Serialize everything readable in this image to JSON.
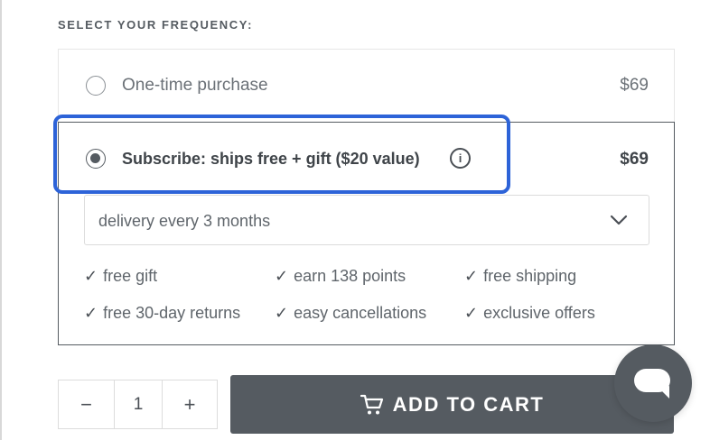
{
  "heading": "SELECT YOUR FREQUENCY:",
  "options": {
    "one_time": {
      "label": "One-time purchase",
      "price": "$69",
      "selected": false
    },
    "subscribe": {
      "label": "Subscribe: ships free + gift ($20 value)",
      "price": "$69",
      "selected": true,
      "info_icon": "i"
    }
  },
  "delivery_select": {
    "value": "delivery every 3 months"
  },
  "perks": {
    "tick": "✓",
    "items": [
      "free gift",
      "earn 138 points",
      "free shipping",
      "free 30-day returns",
      "easy cancellations",
      "exclusive offers"
    ]
  },
  "quantity": {
    "minus": "−",
    "value": "1",
    "plus": "+"
  },
  "add_to_cart": {
    "label": "ADD TO CART"
  },
  "colors": {
    "accent_highlight": "#2d63d8",
    "button": "#555b61"
  }
}
